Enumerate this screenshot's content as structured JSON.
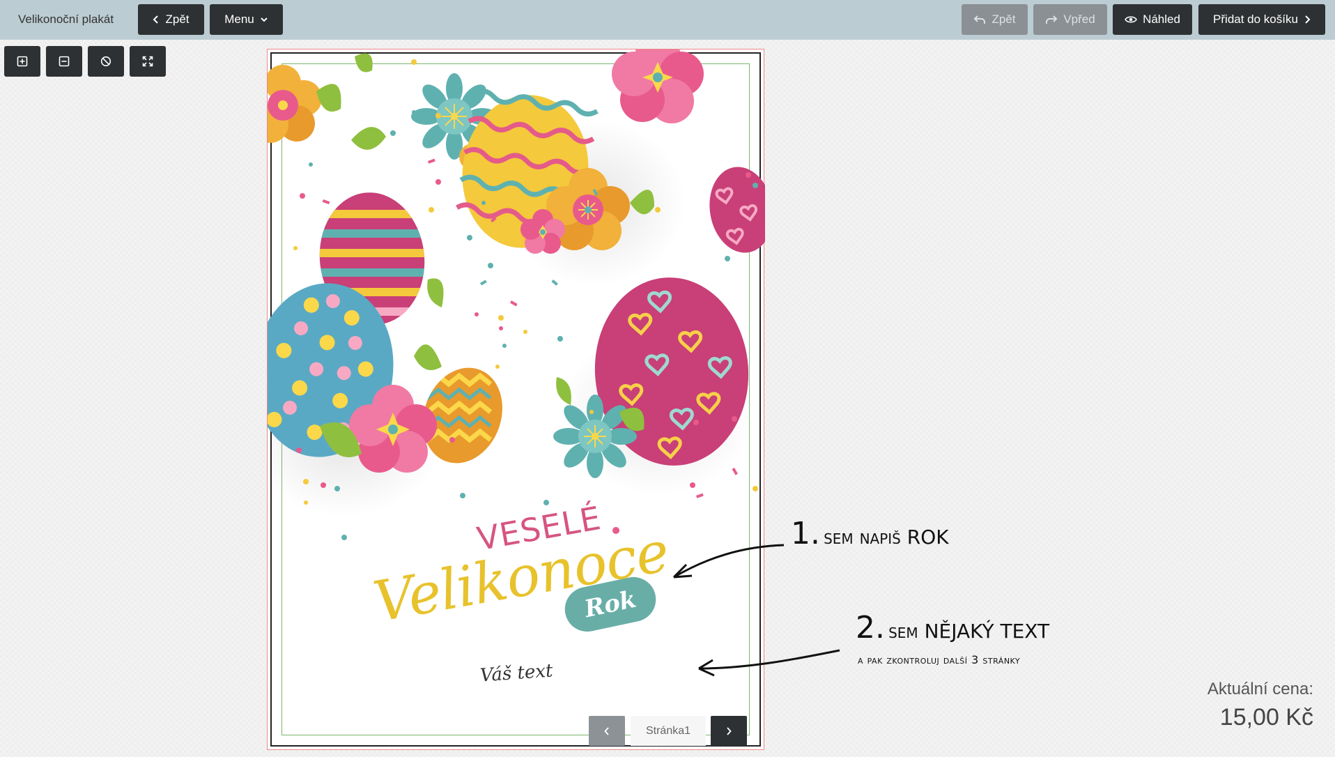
{
  "app": {
    "title": "Velikonoční plakát"
  },
  "header": {
    "back_label": "Zpět",
    "menu_label": "Menu",
    "undo_label": "Zpět",
    "redo_label": "Vpřed",
    "preview_label": "Náhled",
    "add_to_cart_label": "Přidat do košíku"
  },
  "toolbar": {
    "icons": [
      "zoom-in-icon",
      "zoom-out-icon",
      "clear-icon",
      "fit-screen-icon"
    ]
  },
  "poster": {
    "greeting_line1": "VESELÉ",
    "greeting_line2": "Velikonoce",
    "year_placeholder": "Rok",
    "text_placeholder": "Váš text"
  },
  "annotations": {
    "step1_number": "1.",
    "step1_text": "sem napiš ROK",
    "step2_number": "2.",
    "step2_text": "sem NĚJAKÝ TEXT",
    "step2_subtext": "a pak zkontroluj další 3 stránky"
  },
  "pager": {
    "label": "Stránka1"
  },
  "price": {
    "label": "Aktuální cena:",
    "value": "15,00 Kč"
  },
  "colors": {
    "topbar": "#bcccd3",
    "button_dark": "#2e3133",
    "button_disabled": "#8b9094",
    "pink": "#d6557f",
    "yellow": "#e8c22c",
    "teal": "#68aea7"
  }
}
